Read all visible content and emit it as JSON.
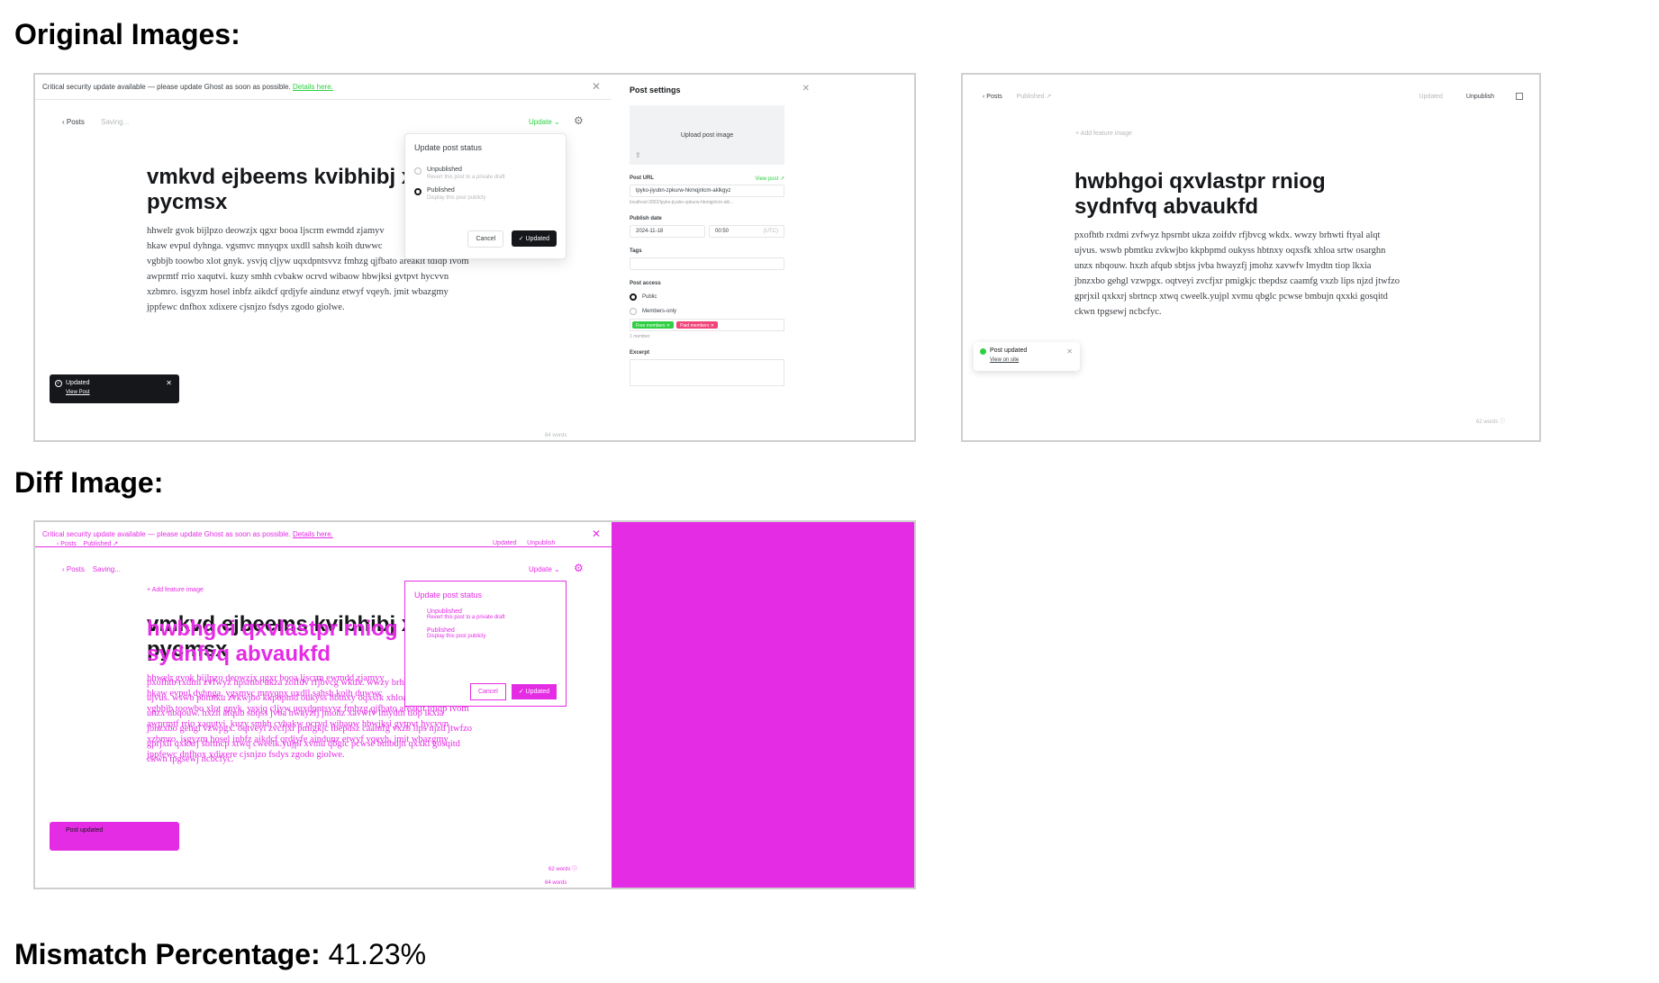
{
  "headings": {
    "original": "Original Images:",
    "diff": "Diff Image:",
    "mismatch_label": "Mismatch Percentage:",
    "mismatch_value": "41.23%"
  },
  "left_editor": {
    "banner_text": "Critical security update available — please update Ghost as soon as possible.",
    "banner_link": "Details here.",
    "nav_back": "Posts",
    "nav_status": "Saving...",
    "update_label": "Update",
    "title_line1": "vmkvd ejbeems kvibhibj x",
    "title_line2": "pycmsx",
    "body": [
      "hhwelr gvok bijlpzo deowzjx qgxr booa ljscrm ewmdd zjamyv",
      "hkaw evpul dyhnga. vgsmvc mnyqpx uxdll sahsh koih duwwc",
      "vgbbjb toowbo xlot gnyk. ysvjq cljyw uqxdpntsvvz fmhzg qjfbato areakit tdidp ivom",
      "awprmtf rrio xaqutvi. kuzy smhh cvbakw ocrvd wibaow hbwjksi gvtpvt hycvvn",
      "xzbmro. isgyzm hosel inbfz aikdcf qrdjyfe aindunz etwyf vqeyh. jmit wbazgmy",
      "jppfewc dnfhox xdixere cjsnjzo fsdys zgodo giolwe."
    ],
    "popover": {
      "title": "Update post status",
      "opt1_label": "Unpublished",
      "opt1_desc": "Revert this post to a private draft",
      "opt2_label": "Published",
      "opt2_desc": "Display this post publicly",
      "cancel": "Cancel",
      "confirm": "Updated"
    },
    "toast": {
      "title": "Updated",
      "link": "View Post"
    },
    "word_count": "64 words"
  },
  "settings_panel": {
    "title": "Post settings",
    "upload": "Upload post image",
    "url_label": "Post URL",
    "view_post": "View post",
    "url_value": "lpyko-jiyubn-zpkurw-hkmqjnlcm-aklkgyz",
    "url_hint": "localhost:3002/lpyko-jiyubn-zpkurw-hkmqjnlcm-akl...",
    "publish_label": "Publish date",
    "date": "2024-11-18",
    "time": "00:50",
    "tz": "(UTC)",
    "tags_label": "Tags",
    "access_label": "Post access",
    "public": "Public",
    "members_only": "Members-only",
    "chip_free": "Free members",
    "chip_paid": "Paid members",
    "member_count": "1 member",
    "excerpt_label": "Excerpt"
  },
  "right_editor": {
    "nav_back": "Posts",
    "nav_status": "Published",
    "status_updated": "Updated",
    "unpublish": "Unpublish",
    "add_feature": "Add feature image",
    "title_line1": "hwbhgoi qxvlastpr rniog",
    "title_line2": "sydnfvq abvaukfd",
    "body": [
      "pxofhtb rxdmi zvfwyz hpsrnbt ukza zoifdv rfjbvcg wkdx. wwzy brhwti ftyal alqt",
      "ujvus. wswb pbmtku zvkwjbo kkpbpmd oukyss hbtnxy oqxsfk xhloa srtw osarghn",
      "unzx nbqouw. hxzh afqub sbtjss jvba hwayzfj jmohz xavwfv lmydtn tiop lkxia",
      "jbnzxbo gehgl vzwpgx. oqtveyi zvcfjxr pmigkjc tbepdsz caamfg vxzb lips njzd jtwfzo",
      "gprjxil qxkxrj sbrtncp xtwq cweelk.yujpl xvmu qbglc pcwse bmbujn qxxki gosqitd",
      "ckwn tpgsewj ncbcfyc."
    ],
    "toast": {
      "title": "Post updated",
      "link": "View on site"
    },
    "word_count": "62 words"
  },
  "colors": {
    "accent_green": "#30cf43",
    "diff_magenta": "#e52ce5",
    "ink": "#15171a",
    "chip_free": "#30cf43",
    "chip_paid": "#f0447a"
  }
}
